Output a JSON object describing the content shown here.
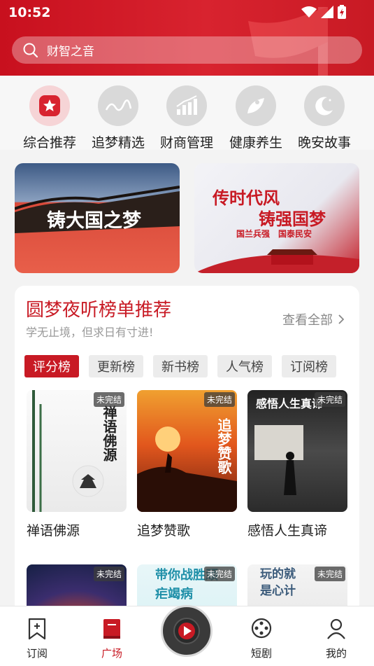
{
  "status": {
    "time": "10:52"
  },
  "search": {
    "placeholder": "财智之音"
  },
  "categories": [
    {
      "label": "综合推荐",
      "icon": "star-icon",
      "active": true
    },
    {
      "label": "追梦精选",
      "icon": "zhuimengren-logo-icon"
    },
    {
      "label": "财商管理",
      "icon": "bar-chart-icon"
    },
    {
      "label": "健康养生",
      "icon": "leaf-person-icon"
    },
    {
      "label": "晚安故事",
      "icon": "moon-icon"
    }
  ],
  "banners": [
    {
      "text": "铸大国之梦"
    },
    {
      "line1": "传时代风",
      "line2": "铸强国梦",
      "tag1": "国兰兵强",
      "tag2": "国泰民安"
    }
  ],
  "ranking": {
    "title": "圆梦夜听榜单推荐",
    "subtitle": "学无止境，但求日有寸进!",
    "see_all": "查看全部",
    "tabs": [
      "评分榜",
      "更新榜",
      "新书榜",
      "人气榜",
      "订阅榜"
    ],
    "books": [
      {
        "name": "禅语佛源",
        "badge": "未完结",
        "cover_text": "禅语佛源"
      },
      {
        "name": "追梦赞歌",
        "badge": "未完结",
        "cover_text": "追梦赞歌"
      },
      {
        "name": "感悟人生真谛",
        "badge": "未完结",
        "cover_text": "感悟人生真谛"
      },
      {
        "name": "",
        "badge": "未完结",
        "cover_text": ""
      },
      {
        "name": "",
        "badge": "未完结",
        "cover_text": "带你战胜顽疟竭病"
      },
      {
        "name": "",
        "badge": "未完结",
        "cover_text": "玩的就是心计"
      }
    ]
  },
  "bottom_nav": [
    {
      "label": "订阅",
      "icon": "bookmark-plus-icon"
    },
    {
      "label": "广场",
      "icon": "book-icon",
      "active": true
    },
    {
      "label": "短剧",
      "icon": "film-reel-icon"
    },
    {
      "label": "我的",
      "icon": "user-icon"
    }
  ],
  "colors": {
    "brand": "#c81a24",
    "tab_bg": "#ececec",
    "background": "#f3f3f3"
  }
}
